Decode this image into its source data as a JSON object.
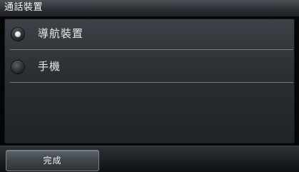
{
  "window": {
    "title": "通話裝置"
  },
  "options": [
    {
      "label": "導航裝置",
      "selected": true
    },
    {
      "label": "手機",
      "selected": false
    }
  ],
  "footer": {
    "done_label": "完成"
  }
}
